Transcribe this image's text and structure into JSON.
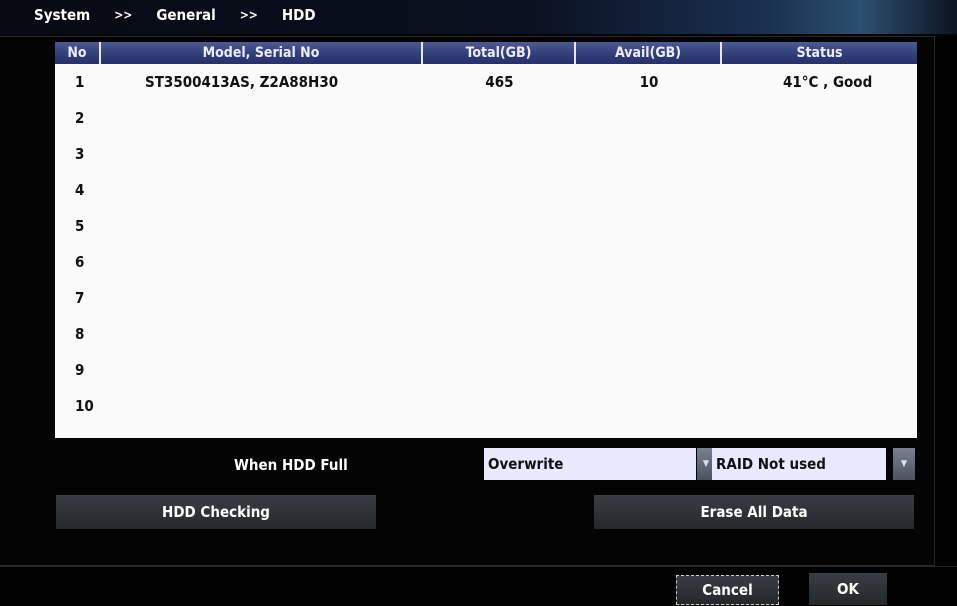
{
  "breadcrumb": {
    "items": [
      "System",
      "General",
      "HDD"
    ],
    "separator": ">>"
  },
  "table": {
    "columns": [
      "No",
      "Model, Serial No",
      "Total(GB)",
      "Avail(GB)",
      "Status"
    ],
    "rows": [
      {
        "no": "1",
        "model": "ST3500413AS, Z2A88H30",
        "total": "465",
        "avail": "10",
        "status": "41°C , Good"
      },
      {
        "no": "2",
        "model": "",
        "total": "",
        "avail": "",
        "status": ""
      },
      {
        "no": "3",
        "model": "",
        "total": "",
        "avail": "",
        "status": ""
      },
      {
        "no": "4",
        "model": "",
        "total": "",
        "avail": "",
        "status": ""
      },
      {
        "no": "5",
        "model": "",
        "total": "",
        "avail": "",
        "status": ""
      },
      {
        "no": "6",
        "model": "",
        "total": "",
        "avail": "",
        "status": ""
      },
      {
        "no": "7",
        "model": "",
        "total": "",
        "avail": "",
        "status": ""
      },
      {
        "no": "8",
        "model": "",
        "total": "",
        "avail": "",
        "status": ""
      },
      {
        "no": "9",
        "model": "",
        "total": "",
        "avail": "",
        "status": ""
      },
      {
        "no": "10",
        "model": "",
        "total": "",
        "avail": "",
        "status": ""
      }
    ]
  },
  "settings": {
    "when_full_label": "When HDD Full",
    "when_full_value": "Overwrite",
    "raid_value": "RAID Not used"
  },
  "buttons": {
    "hdd_checking": "HDD Checking",
    "erase_all": "Erase All Data",
    "cancel": "Cancel",
    "ok": "OK"
  },
  "icons": {
    "dropdown": "chevron-down-icon"
  },
  "colors": {
    "header_bg": "#323e78",
    "select_bg": "#e9e9ff",
    "table_bg": "#fafafa"
  }
}
